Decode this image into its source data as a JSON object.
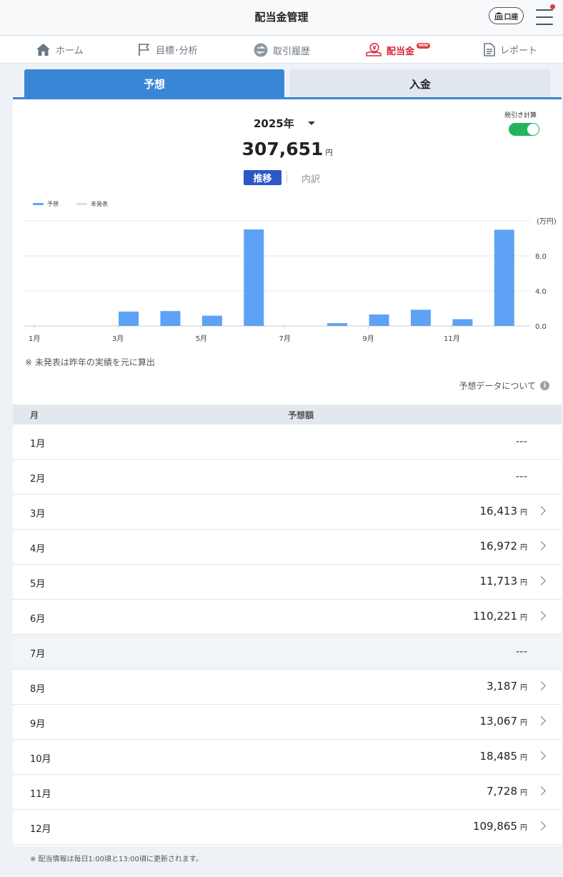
{
  "header": {
    "title": "配当金管理",
    "account_label": "口座"
  },
  "nav": [
    {
      "label": "ホーム",
      "icon": "home-icon"
    },
    {
      "label": "目標･分析",
      "icon": "flag-icon"
    },
    {
      "label": "取引履歴",
      "icon": "exchange-icon"
    },
    {
      "label": "配当金",
      "icon": "dividend-icon",
      "badge": "NEW",
      "active": true
    },
    {
      "label": "レポート",
      "icon": "report-icon"
    }
  ],
  "tabs": {
    "forecast": "予想",
    "deposit": "入金"
  },
  "summary": {
    "year": "2025年",
    "total": "307,651",
    "currency": "円",
    "tax_toggle_label": "税引き計算",
    "tax_toggle_on": true,
    "view_trend": "推移",
    "view_breakdown": "内訳"
  },
  "legend": {
    "forecast": "予想",
    "unannounced": "未発表"
  },
  "colors": {
    "forecast": "#5ea2f5",
    "unannounced": "#cfe0f5",
    "accent": "#3a86d6",
    "active_nav": "#d6283a",
    "toggle_on": "#22b55c"
  },
  "chart_data": {
    "type": "bar",
    "categories": [
      "1月",
      "2月",
      "3月",
      "4月",
      "5月",
      "6月",
      "7月",
      "8月",
      "9月",
      "10月",
      "11月",
      "12月"
    ],
    "x_tick_labels": [
      "1月",
      "3月",
      "5月",
      "7月",
      "9月",
      "11月"
    ],
    "series": [
      {
        "name": "予想",
        "values": [
          0,
          0,
          1.6413,
          1.6972,
          1.1713,
          11.0221,
          0,
          0.3187,
          1.3067,
          1.8485,
          0.7728,
          10.9865
        ]
      }
    ],
    "ylabel": "(万円)",
    "y_ticks": [
      "0.0",
      "4.0",
      "8.0"
    ],
    "ylim": [
      0,
      12
    ],
    "grid": true,
    "legend_position": "top-left"
  },
  "notes": {
    "unannounced_note": "※ 未発表は昨年の実績を元に算出",
    "about_link": "予想データについて",
    "footnote": "※ 配当情報は毎日1:00頃と13:00頃に更新されます。"
  },
  "table": {
    "col_month": "月",
    "col_amount": "予想額",
    "unit": "円",
    "rows": [
      {
        "month": "1月",
        "amount": "---"
      },
      {
        "month": "2月",
        "amount": "---"
      },
      {
        "month": "3月",
        "amount": "16,413"
      },
      {
        "month": "4月",
        "amount": "16,972"
      },
      {
        "month": "5月",
        "amount": "11,713"
      },
      {
        "month": "6月",
        "amount": "110,221"
      },
      {
        "month": "7月",
        "amount": "---"
      },
      {
        "month": "8月",
        "amount": "3,187"
      },
      {
        "month": "9月",
        "amount": "13,067"
      },
      {
        "month": "10月",
        "amount": "18,485"
      },
      {
        "month": "11月",
        "amount": "7,728"
      },
      {
        "month": "12月",
        "amount": "109,865"
      }
    ]
  }
}
